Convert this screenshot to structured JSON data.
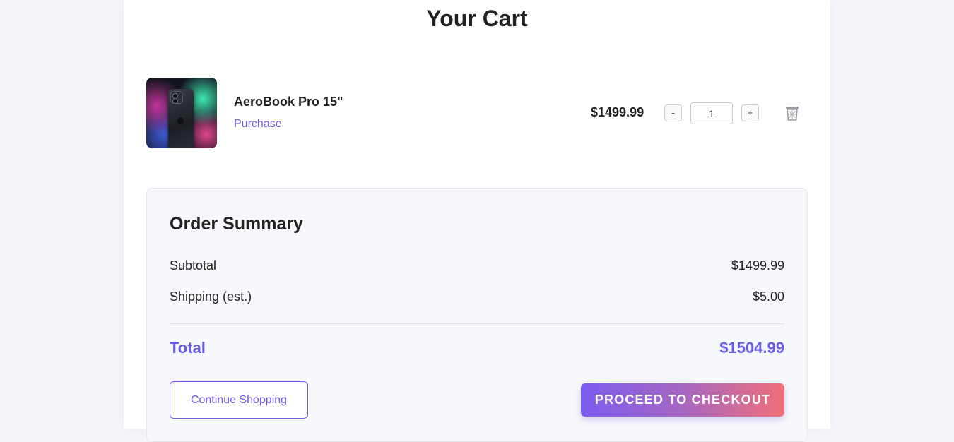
{
  "cart": {
    "title": "Your Cart"
  },
  "items": [
    {
      "name": "AeroBook Pro 15\"",
      "type": "Purchase",
      "price": "$1499.99",
      "quantity": "1",
      "minus_label": "-",
      "plus_label": "+"
    }
  ],
  "summary": {
    "title": "Order Summary",
    "subtotal_label": "Subtotal",
    "subtotal_value": "$1499.99",
    "shipping_label": "Shipping (est.)",
    "shipping_value": "$5.00",
    "total_label": "Total",
    "total_value": "$1504.99",
    "continue_label": "Continue Shopping",
    "checkout_label": "PROCEED TO CHECKOUT"
  },
  "icons": {
    "product": "product-thumbnail",
    "remove": "trash-icon"
  },
  "colors": {
    "accent": "#6b5be6",
    "checkout_gradient_start": "#7b5cf0",
    "checkout_gradient_end": "#f06f78"
  }
}
